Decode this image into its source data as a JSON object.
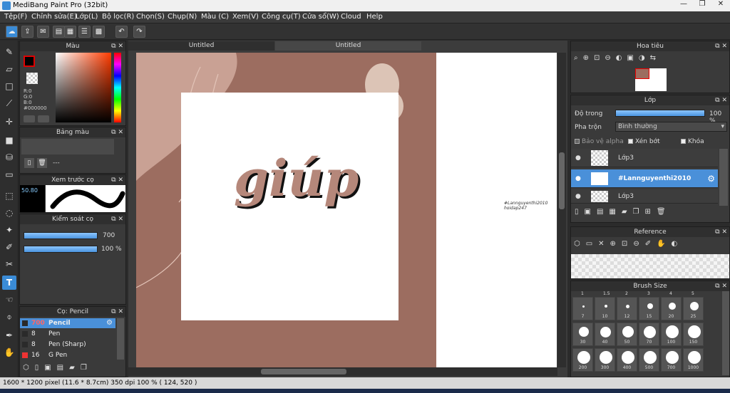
{
  "window": {
    "title": "MediBang Paint Pro (32bit)",
    "buttons": [
      "—",
      "❐",
      "✕"
    ]
  },
  "menu": [
    "Tệp(F)",
    "Chỉnh sửa(E)",
    "Lớp(L)",
    "Bộ lọc(R)",
    "Chọn(S)",
    "Chụp(N)",
    "Màu (C)",
    "Xem(V)",
    "Công cụ(T)",
    "Cửa sổ(W)",
    "Cloud",
    "Help"
  ],
  "tabs": [
    "Untitled",
    "Untitled"
  ],
  "panels": {
    "color": {
      "title": "Màu",
      "r": "R:0",
      "g": "G:0",
      "b": "B:0",
      "hex": "#000000"
    },
    "palette": {
      "title": "Bảng màu",
      "item": "---"
    },
    "preview": {
      "title": "Xem trước cọ",
      "size": "50.80"
    },
    "control": {
      "title": "Kiểm soát cọ",
      "size_val": "700",
      "opacity_val": "100 %"
    },
    "brush": {
      "title": "Cọ: Pencil",
      "items": [
        {
          "size": "700",
          "name": "Pencil",
          "color": "#2a2a2a"
        },
        {
          "size": "8",
          "name": "Pen",
          "color": "#2a2a2a"
        },
        {
          "size": "8",
          "name": "Pen (Sharp)",
          "color": "#2a2a2a"
        },
        {
          "size": "16",
          "name": "G Pen",
          "color": "#e33"
        }
      ]
    },
    "navigator": {
      "title": "Hoa tiêu"
    },
    "layer": {
      "title": "Lớp",
      "opacity_label": "Độ trong",
      "opacity_val": "100 %",
      "blend_label": "Pha trộn",
      "blend_val": "Bình thường",
      "protect_alpha": "Bảo vệ alpha",
      "clip": "Xén bớt",
      "lock": "Khóa",
      "layers": [
        "Lớp3",
        "#Lannguyenthi2010",
        "Lớp3"
      ]
    },
    "reference": {
      "title": "Reference"
    },
    "brushsize": {
      "title": "Brush Size",
      "headers": [
        "1",
        "1.5",
        "2",
        "3",
        "4",
        "5"
      ],
      "rows": [
        [
          "7",
          "10",
          "12",
          "15",
          "20",
          "25"
        ],
        [
          "30",
          "40",
          "50",
          "70",
          "100",
          "150"
        ],
        [
          "200",
          "300",
          "400",
          "500",
          "700",
          "1000"
        ]
      ]
    }
  },
  "canvas": {
    "text": "giúp",
    "watermark1": "#Lannguyenthi2010",
    "watermark2": "hoidap247"
  },
  "status": "1600 * 1200 pixel   (11.6 * 8.7cm)   350 dpi   100 %   ( 124, 520 )"
}
